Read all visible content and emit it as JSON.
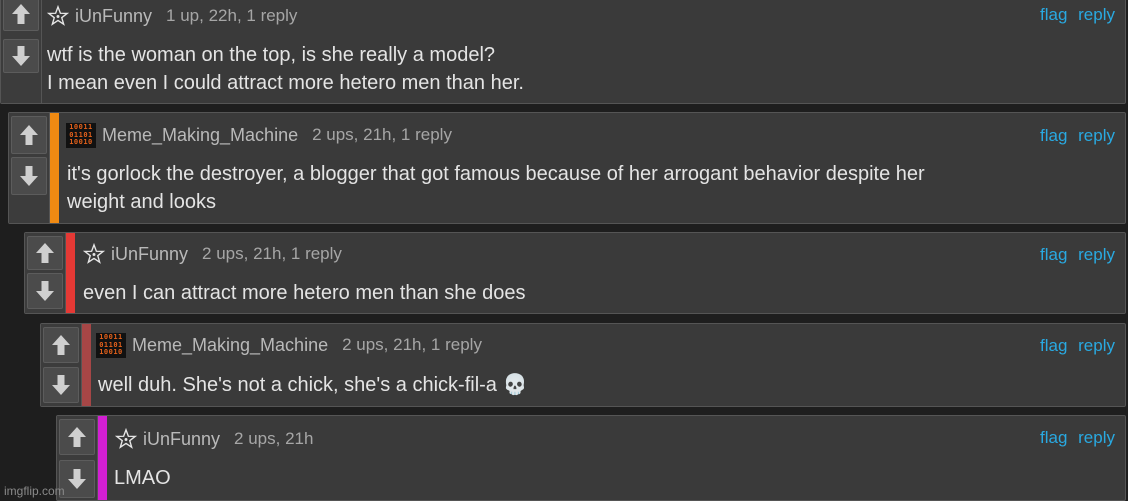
{
  "comments": [
    {
      "username": "iUnFunny",
      "avatar_icon": "star-icon",
      "meta": "1 up, 22h, 1 reply",
      "flag": "flag",
      "reply": "reply",
      "text_lines": [
        "wtf is the woman on the top, is she really a model?",
        "I mean even I could attract more hetero men than her."
      ],
      "accent_color": ""
    },
    {
      "username": "Meme_Making_Machine",
      "avatar_icon": "binary-avatar-icon",
      "avatar_text": "10011\n01101\n10010",
      "meta": "2 ups, 21h, 1 reply",
      "flag": "flag",
      "reply": "reply",
      "text_lines": [
        "it's gorlock the destroyer, a blogger that got famous because of her arrogant behavior despite her",
        "weight and looks"
      ],
      "accent_color": "#f08a12"
    },
    {
      "username": "iUnFunny",
      "avatar_icon": "star-icon",
      "meta": "2 ups, 21h, 1 reply",
      "flag": "flag",
      "reply": "reply",
      "text_lines": [
        "even I can attract more hetero men than she does"
      ],
      "accent_color": "#e53935"
    },
    {
      "username": "Meme_Making_Machine",
      "avatar_icon": "binary-avatar-icon",
      "avatar_text": "10011\n01101\n10010",
      "meta": "2 ups, 21h, 1 reply",
      "flag": "flag",
      "reply": "reply",
      "text_lines": [
        "well duh. She's not a chick, she's a chick-fil-a 💀"
      ],
      "accent_color": "#a64646"
    },
    {
      "username": "iUnFunny",
      "avatar_icon": "star-icon",
      "meta": "2 ups, 21h",
      "flag": "flag",
      "reply": "reply",
      "text_lines": [
        "LMAO"
      ],
      "accent_color": "#d21fd2"
    }
  ],
  "watermark": "imgflip.com"
}
